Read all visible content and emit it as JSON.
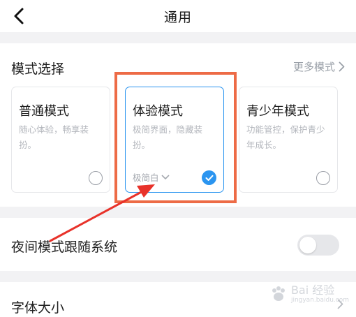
{
  "header": {
    "title": "通用"
  },
  "mode_section": {
    "title": "模式选择",
    "more_label": "更多模式",
    "cards": [
      {
        "title": "普通模式",
        "description": "随心体验，畅享装扮。",
        "selected": false
      },
      {
        "title": "体验模式",
        "description": "极简界面，隐藏装扮。",
        "selected": true,
        "theme_label": "极简白"
      },
      {
        "title": "青少年模式",
        "description": "功能管控，保护青少年成长。",
        "selected": false
      }
    ]
  },
  "night_mode": {
    "label": "夜间模式跟随系统",
    "enabled": false
  },
  "font_size": {
    "label": "字体大小"
  },
  "colors": {
    "accent": "#2b95f0",
    "annotation": "#ed6b46",
    "arrow": "#e8322a"
  },
  "watermark": {
    "text": "Bai 经验",
    "subtext": "jingyan.baidu.com"
  }
}
